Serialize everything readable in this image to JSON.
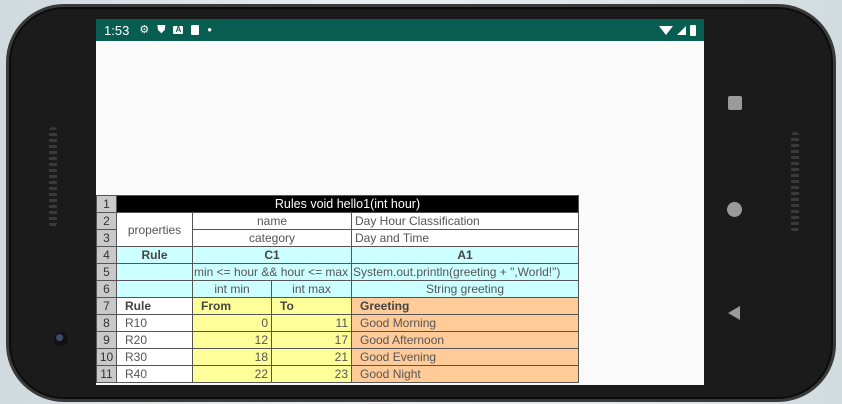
{
  "status_bar": {
    "time": "1:53",
    "left_icons": [
      "gear-icon",
      "shield-icon",
      "a-icon",
      "sim-icon",
      "dot-icon"
    ],
    "right_icons": [
      "wifi-icon",
      "signal-icon",
      "battery-icon"
    ]
  },
  "sheet": {
    "row_numbers": [
      "1",
      "2",
      "3",
      "4",
      "5",
      "6",
      "7",
      "8",
      "9",
      "10",
      "11"
    ],
    "title": "Rules void hello1(int hour)",
    "properties_label": "properties",
    "prop_name_key": "name",
    "prop_name_value": "Day Hour Classification",
    "prop_category_key": "category",
    "prop_category_value": "Day and Time",
    "rule_label": "Rule",
    "c1_label": "C1",
    "a1_label": "A1",
    "c1_expression": "min <= hour && hour <= max",
    "a1_expression": "System.out.println(greeting + \",World!\")",
    "param_min": "int min",
    "param_max": "int max",
    "param_greeting": "String greeting",
    "header_rule": "Rule",
    "header_from": "From",
    "header_to": "To",
    "header_greeting": "Greeting",
    "rows": [
      {
        "rule": "R10",
        "from": "0",
        "to": "11",
        "greeting": "Good Morning"
      },
      {
        "rule": "R20",
        "from": "12",
        "to": "17",
        "greeting": "Good Afternoon"
      },
      {
        "rule": "R30",
        "from": "18",
        "to": "21",
        "greeting": "Good Evening"
      },
      {
        "rule": "R40",
        "from": "22",
        "to": "23",
        "greeting": "Good Night"
      }
    ]
  },
  "nav_buttons": [
    "overview-button",
    "home-button",
    "back-button"
  ]
}
